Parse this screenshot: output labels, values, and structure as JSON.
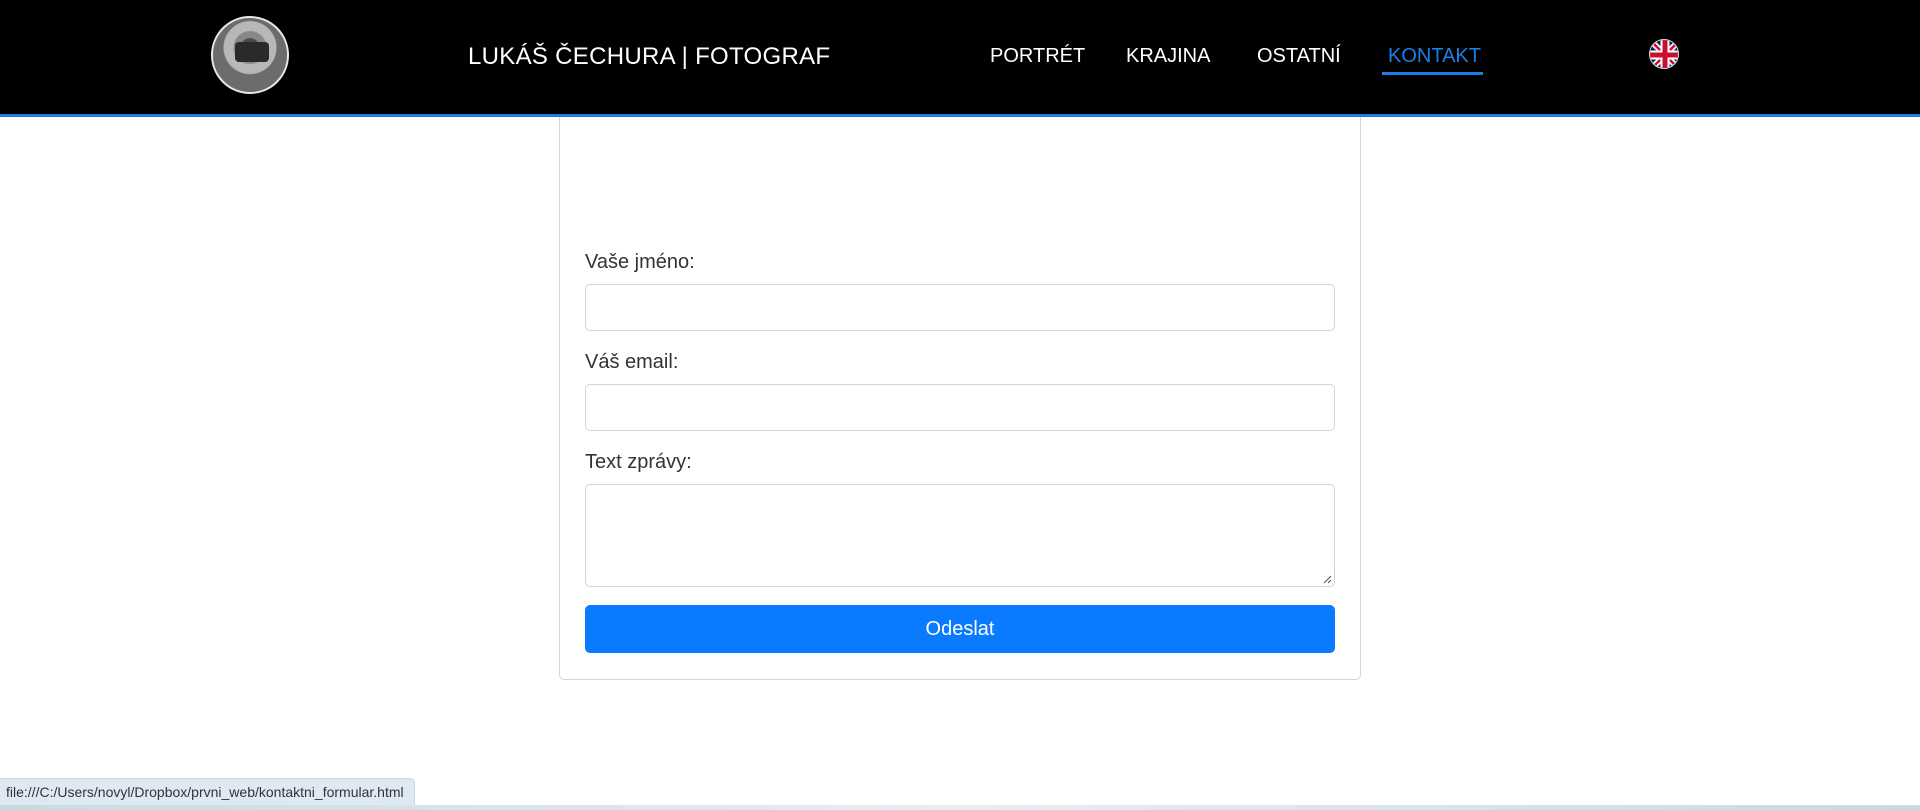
{
  "header": {
    "brand": "LUKÁŠ ČECHURA | FOTOGRAF",
    "avatar_icon": "photographer-avatar",
    "nav": [
      {
        "label": "PORTRÉT",
        "active": false
      },
      {
        "label": "KRAJINA",
        "active": false
      },
      {
        "label": "OSTATNÍ",
        "active": false
      },
      {
        "label": "KONTAKT",
        "active": true
      }
    ],
    "language_icon": "uk-flag-icon",
    "accent_color": "#1a7fe8"
  },
  "form": {
    "name_label": "Vaše jméno:",
    "name_value": "",
    "email_label": "Váš email:",
    "email_value": "",
    "message_label": "Text zprávy:",
    "message_value": "",
    "submit_label": "Odeslat",
    "submit_color": "#0a7bff"
  },
  "status_bar": {
    "url": "file:///C:/Users/novyl/Dropbox/prvni_web/kontaktni_formular.html"
  }
}
